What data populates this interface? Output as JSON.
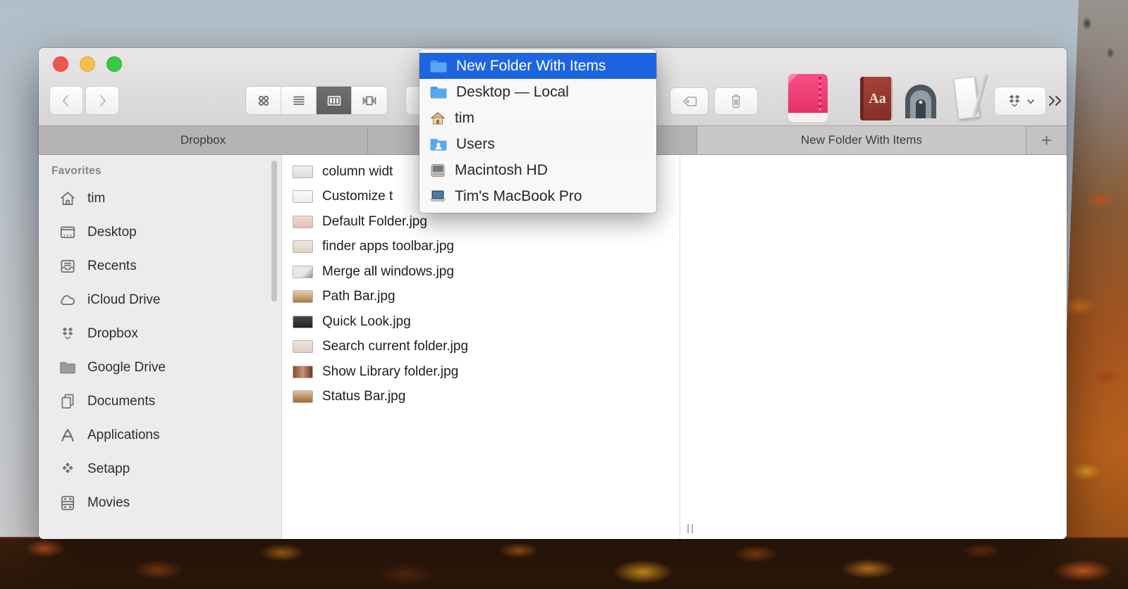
{
  "colors": {
    "menu_highlight": "#1d65e0",
    "tab_active": "#c9c7c8",
    "tab_inactive": "#b5b3b4",
    "pink_app": "#f03a72",
    "dictionary_red": "#97352c",
    "folder_blue": "#57a8ef"
  },
  "menu": {
    "items": [
      {
        "label": "New Folder With Items",
        "icon": "folder-icon",
        "selected": true
      },
      {
        "label": "Desktop — Local",
        "icon": "folder-icon",
        "selected": false
      },
      {
        "label": "tim",
        "icon": "home-icon",
        "selected": false
      },
      {
        "label": "Users",
        "icon": "users-folder-icon",
        "selected": false
      },
      {
        "label": "Macintosh HD",
        "icon": "hard-drive-icon",
        "selected": false
      },
      {
        "label": "Tim's MacBook Pro",
        "icon": "laptop-icon",
        "selected": false
      }
    ]
  },
  "toolbar": {
    "icons": [
      "back",
      "forward",
      "icon-view",
      "list-view",
      "column-view",
      "coverflow-view",
      "tag",
      "trash",
      "default-folder-app",
      "dictionary-app",
      "arch-app",
      "paper-pencil-app",
      "dropbox",
      "overflow-chevrons"
    ],
    "selected_view": "column-view",
    "dictionary_label": "Aa"
  },
  "window": {
    "tabs": [
      {
        "label": "Dropbox",
        "active": false
      },
      {
        "label": "",
        "active": false
      },
      {
        "label": "New Folder With Items",
        "active": true
      }
    ],
    "new_tab_label": "+",
    "sidebar": {
      "heading": "Favorites",
      "items": [
        {
          "label": "tim",
          "icon": "home-icon"
        },
        {
          "label": "Desktop",
          "icon": "desktop-icon"
        },
        {
          "label": "Recents",
          "icon": "recents-icon"
        },
        {
          "label": "iCloud Drive",
          "icon": "icloud-icon"
        },
        {
          "label": "Dropbox",
          "icon": "dropbox-icon"
        },
        {
          "label": "Google Drive",
          "icon": "folder-icon"
        },
        {
          "label": "Documents",
          "icon": "documents-icon"
        },
        {
          "label": "Applications",
          "icon": "applications-icon"
        },
        {
          "label": "Setapp",
          "icon": "setapp-icon"
        },
        {
          "label": "Movies",
          "icon": "movies-icon"
        }
      ]
    },
    "files": [
      "column widt",
      "Customize t",
      "Default Folder.jpg",
      "finder apps toolbar.jpg",
      "Merge all windows.jpg",
      "Path Bar.jpg",
      "Quick Look.jpg",
      "Search current folder.jpg",
      "Show Library folder.jpg",
      "Status Bar.jpg"
    ]
  }
}
